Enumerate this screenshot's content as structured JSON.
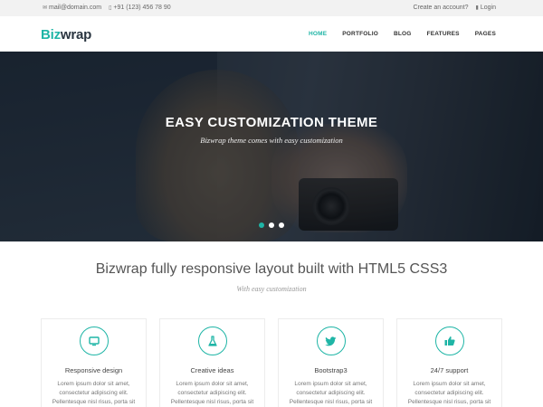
{
  "topbar": {
    "email": "mail@domain.com",
    "phone": "+91 (123) 456 78 90",
    "create_account": "Create an account?",
    "login": "Login"
  },
  "header": {
    "logo_part1": "Biz",
    "logo_part2": "wrap",
    "nav": [
      "HOME",
      "PORTFOLIO",
      "BLOG",
      "FEATURES",
      "PAGES"
    ],
    "active_nav": "HOME"
  },
  "hero": {
    "title": "EASY CUSTOMIZATION THEME",
    "subtitle": "Bizwrap theme comes with easy customization",
    "slides": 3,
    "active_slide": 1
  },
  "intro": {
    "title": "Bizwrap fully responsive layout built with HTML5 CSS3",
    "subtitle": "With easy customization"
  },
  "features": [
    {
      "icon": "monitor-icon",
      "title": "Responsive design",
      "lines": [
        "Lorem ipsum dolor sit amet,",
        "consectetur adipiscing elit.",
        "Pellentesque nisl risus, porta sit"
      ]
    },
    {
      "icon": "flask-icon",
      "title": "Creative ideas",
      "lines": [
        "Lorem ipsum dolor sit amet,",
        "consectetur adipiscing elit.",
        "Pellentesque nisl risus, porta sit"
      ]
    },
    {
      "icon": "twitter-icon",
      "title": "Bootstrap3",
      "lines": [
        "Lorem ipsum dolor sit amet,",
        "consectetur adipiscing elit.",
        "Pellentesque nisl risus, porta sit"
      ]
    },
    {
      "icon": "thumbs-up-icon",
      "title": "24/7 support",
      "lines": [
        "Lorem ipsum dolor sit amet,",
        "consectetur adipiscing elit.",
        "Pellentesque nisl risus, porta sit"
      ]
    }
  ],
  "colors": {
    "accent": "#1fb5a6",
    "logo_dark": "#2a3540",
    "topbar_bg": "#f2f2f2"
  }
}
